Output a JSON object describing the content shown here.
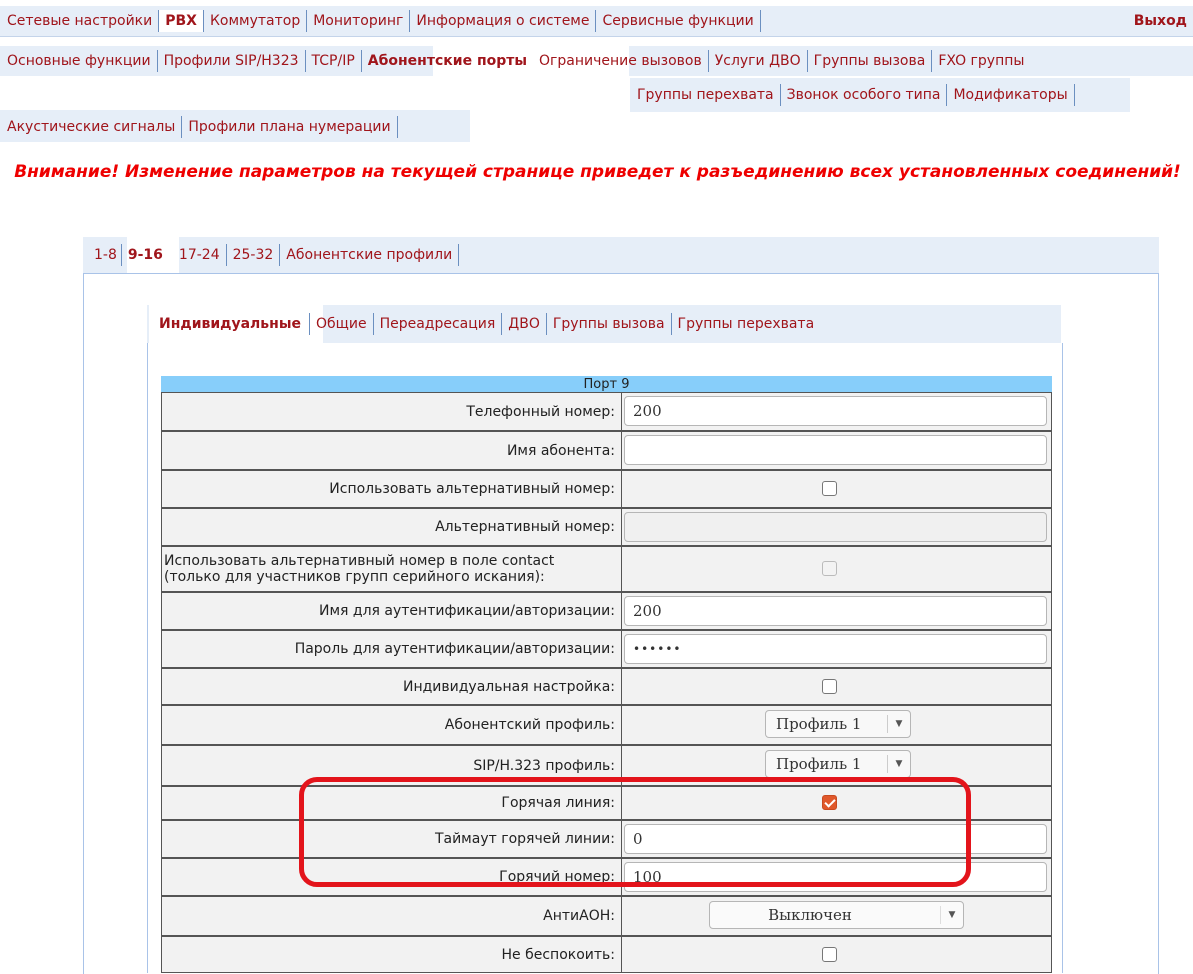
{
  "main_nav": {
    "items": [
      "Сетевые настройки",
      "PBX",
      "Коммутатор",
      "Мониторинг",
      "Информация о системе",
      "Сервисные функции"
    ],
    "logout": "Выход"
  },
  "sub_nav": {
    "row1": [
      "Основные функции",
      "Профили SIP/H323",
      "TCP/IP",
      "Абонентские порты",
      "Ограничение вызовов",
      "Услуги ДВО",
      "Группы вызова",
      "FXO группы"
    ],
    "row2": [
      "Группы перехвата",
      "Звонок особого типа",
      "Модификаторы"
    ],
    "row3": [
      "Акустические сигналы",
      "Профили плана нумерации"
    ]
  },
  "warning": "Внимание! Изменение параметров на текущей странице приведет к разъединению всех установленных соединений!",
  "port_tabs": [
    "1-8",
    "9-16",
    "17-24",
    "25-32",
    "Абонентские профили"
  ],
  "inner_tabs": [
    "Индивидуальные",
    "Общие",
    "Переадресация",
    "ДВО",
    "Группы вызова",
    "Группы перехвата"
  ],
  "table": {
    "header": "Порт 9",
    "rows": {
      "phone_label": "Телефонный номер:",
      "phone_value": "200",
      "name_label": "Имя абонента:",
      "name_value": "",
      "use_alt_label": "Использовать альтернативный номер:",
      "alt_label": "Альтернативный номер:",
      "alt_contact_label_1": "Использовать альтернативный номер в поле contact",
      "alt_contact_label_2": "(только для участников групп серийного искания):",
      "auth_name_label": "Имя для аутентификации/авторизации:",
      "auth_name_value": "200",
      "auth_pass_label": "Пароль для аутентификации/авторизации:",
      "auth_pass_value": "••••••",
      "individual_label": "Индивидуальная настройка:",
      "sub_profile_label": "Абонентский профиль:",
      "sub_profile_value": "Профиль 1",
      "sip_profile_label": "SIP/H.323 профиль:",
      "sip_profile_value": "Профиль 1",
      "hotline_label": "Горячая линия:",
      "hotline_timeout_label": "Таймаут горячей линии:",
      "hotline_timeout_value": "0",
      "hot_number_label": "Горячий номер:",
      "hot_number_value": "100",
      "antiaon_label": "АнтиАОН:",
      "antiaon_value": "Выключен",
      "dnd_label": "Не беспокоить:"
    },
    "checkboxes": {
      "use_alt": false,
      "alt_contact": false,
      "individual": false,
      "hotline": true,
      "dnd": false
    }
  }
}
